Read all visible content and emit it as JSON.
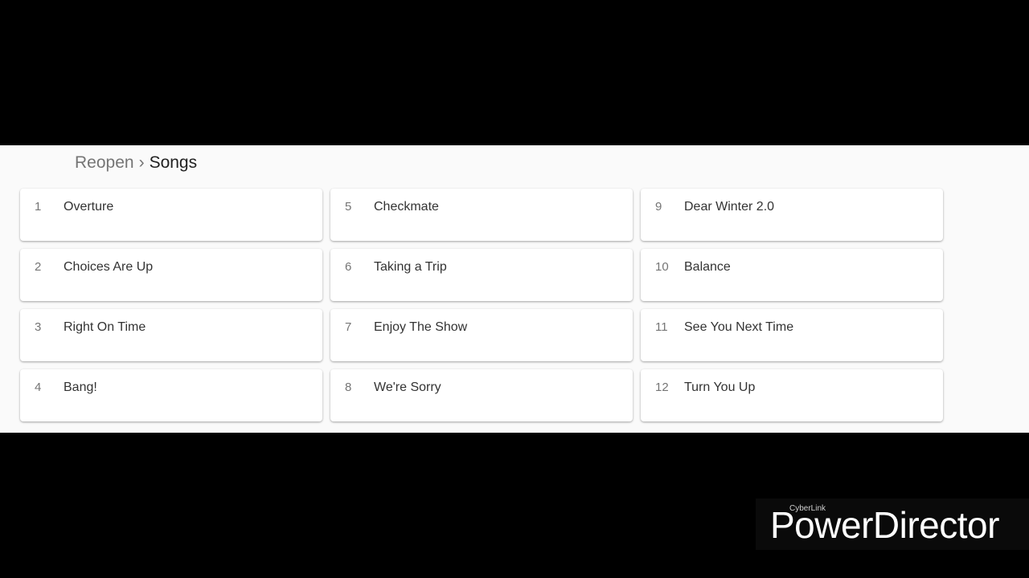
{
  "breadcrumb": {
    "parent": "Reopen",
    "separator": "›",
    "current": "Songs"
  },
  "tracks": [
    {
      "number": "1",
      "title": "Overture"
    },
    {
      "number": "2",
      "title": "Choices Are Up"
    },
    {
      "number": "3",
      "title": "Right On Time"
    },
    {
      "number": "4",
      "title": "Bang!"
    },
    {
      "number": "5",
      "title": "Checkmate"
    },
    {
      "number": "6",
      "title": "Taking a Trip"
    },
    {
      "number": "7",
      "title": "Enjoy The Show"
    },
    {
      "number": "8",
      "title": "We're Sorry"
    },
    {
      "number": "9",
      "title": "Dear Winter 2.0"
    },
    {
      "number": "10",
      "title": "Balance"
    },
    {
      "number": "11",
      "title": "See You Next Time"
    },
    {
      "number": "12",
      "title": "Turn You Up"
    }
  ],
  "watermark": {
    "small": "CyberLink",
    "large": "PowerDirector"
  },
  "colors": {
    "panel_background": "#fafafa",
    "letterbox": "#000000",
    "card_background": "#ffffff"
  }
}
